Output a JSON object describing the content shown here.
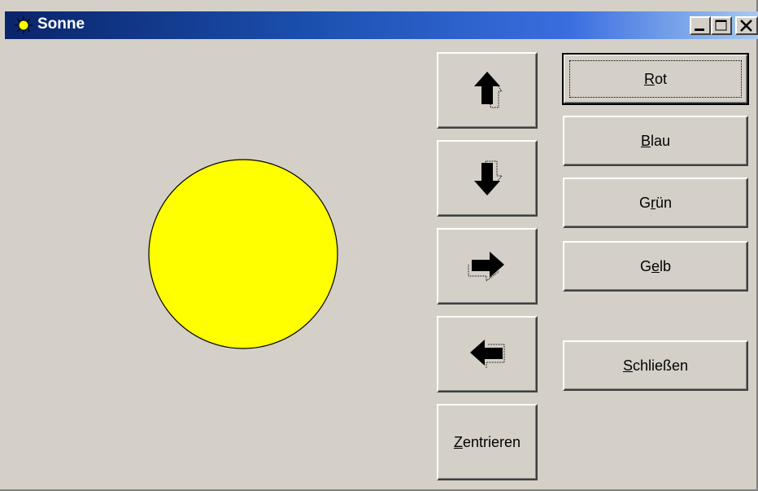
{
  "window": {
    "title": "Sonne",
    "title_icon": "sun-icon",
    "controls": [
      "minimize-icon",
      "maximize-icon",
      "close-icon"
    ]
  },
  "canvas": {
    "shape": "circle",
    "fill_color": "#ffff00",
    "stroke_color": "#000000"
  },
  "move_buttons": [
    {
      "name": "move-up-button",
      "icon": "arrow-up-icon"
    },
    {
      "name": "move-down-button",
      "icon": "arrow-down-icon"
    },
    {
      "name": "move-right-button",
      "icon": "arrow-right-icon"
    },
    {
      "name": "move-left-button",
      "icon": "arrow-left-icon"
    }
  ],
  "buttons": {
    "center": {
      "pre": "",
      "accel": "Z",
      "post": "entrieren"
    },
    "red": {
      "pre": "",
      "accel": "R",
      "post": "ot"
    },
    "blue": {
      "pre": "",
      "accel": "B",
      "post": "lau"
    },
    "green": {
      "pre": "G",
      "accel": "r",
      "post": "ün"
    },
    "yellow": {
      "pre": "G",
      "accel": "e",
      "post": "lb"
    },
    "close": {
      "pre": "",
      "accel": "S",
      "post": "chließen"
    }
  },
  "colors": {
    "face": "#d4d0c8",
    "title_start": "#0a246a",
    "title_end": "#a6caf0",
    "sun": "#ffff00"
  }
}
